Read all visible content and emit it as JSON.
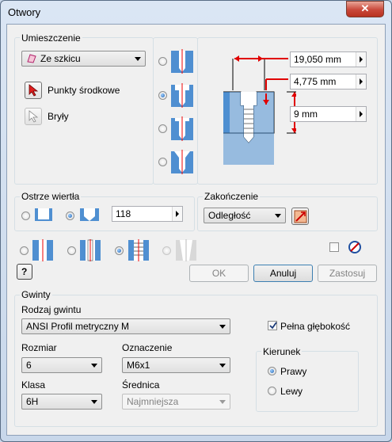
{
  "window": {
    "title": "Otwory",
    "close_glyph": "✕"
  },
  "placement": {
    "group_label": "Umieszczenie",
    "mode_value": "Ze szkicu",
    "centers_label": "Punkty środkowe",
    "solids_label": "Bryły"
  },
  "dimensions": {
    "d1": "19,050 mm",
    "d2": "4,775 mm",
    "d3": "9 mm"
  },
  "drill_point": {
    "group_label": "Ostrze wiertła",
    "angle": "118"
  },
  "termination": {
    "group_label": "Zakończenie",
    "value": "Odległość"
  },
  "buttons": {
    "ok": "OK",
    "cancel": "Anuluj",
    "apply": "Zastosuj",
    "help_glyph": "?"
  },
  "threads": {
    "group_label": "Gwinty",
    "type_label": "Rodzaj gwintu",
    "type_value": "ANSI Profil metryczny M",
    "full_depth_label": "Pełna głębokość",
    "size_label": "Rozmiar",
    "size_value": "6",
    "designation_label": "Oznaczenie",
    "designation_value": "M6x1",
    "class_label": "Klasa",
    "class_value": "6H",
    "diameter_label": "Średnica",
    "diameter_value": "Najmniejsza",
    "direction_label": "Kierunek",
    "right_label": "Prawy",
    "left_label": "Lewy"
  },
  "colors": {
    "accent": "#3c7fb1",
    "close": "#c9483a",
    "dimension": "#e00000",
    "metal": "#4f8fd1"
  }
}
